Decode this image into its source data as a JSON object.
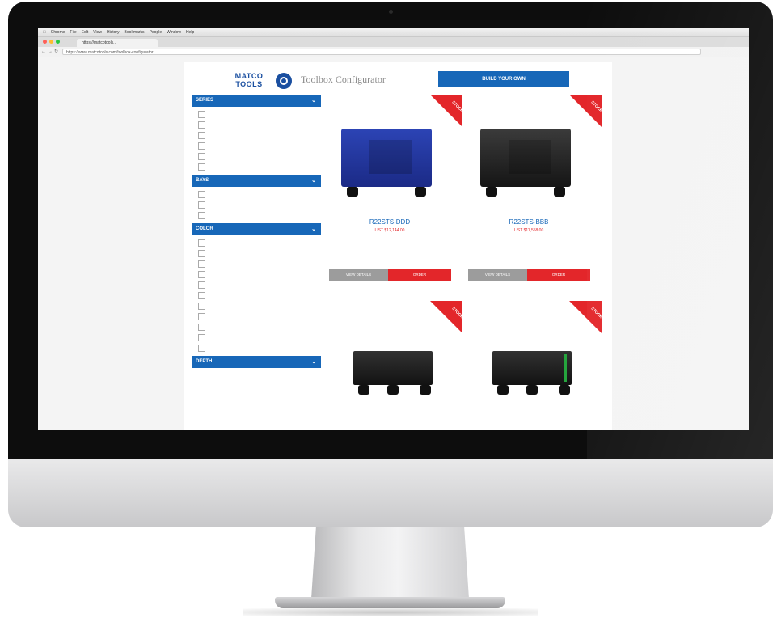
{
  "browser": {
    "menu_items": [
      "Chrome",
      "File",
      "Edit",
      "View",
      "History",
      "Bookmarks",
      "People",
      "Window",
      "Help"
    ],
    "tab_title": "https://matcotools...",
    "url": "https://www.matcotools.com/toolbox-configurator"
  },
  "page": {
    "logo_text": "MATCO TOOLS",
    "title": "Toolbox Configurator",
    "build_button": "BUILD YOUR OWN"
  },
  "filters": [
    {
      "label": "SERIES",
      "items": [
        "",
        "",
        "",
        "",
        "",
        ""
      ]
    },
    {
      "label": "BAYS",
      "items": [
        "",
        "",
        ""
      ]
    },
    {
      "label": "COLOR",
      "items": [
        "",
        "",
        "",
        "",
        "",
        "",
        "",
        "",
        "",
        "",
        ""
      ]
    },
    {
      "label": "DEPTH",
      "items": []
    }
  ],
  "products": [
    {
      "model": "R22STS-DDD",
      "price": "LIST $12,144.00",
      "desc": "",
      "stock": "STOCK",
      "color": "#2c44b5",
      "details_label": "VIEW DETAILS",
      "order_label": "ORDER"
    },
    {
      "model": "R22STS-BBB",
      "price": "LIST $11,558.00",
      "desc": "",
      "stock": "STOCK",
      "color": "#2a2a2a",
      "details_label": "VIEW DETAILS",
      "order_label": "ORDER"
    },
    {
      "model": "",
      "price": "",
      "desc": "",
      "stock": "STOCK",
      "color": "#1e1e1e"
    },
    {
      "model": "",
      "price": "",
      "desc": "",
      "stock": "STOCK",
      "color": "#1e1e1e",
      "accent": "#25a53d"
    }
  ],
  "colors": {
    "brand_blue": "#1767b8",
    "stock_red": "#e3262a"
  }
}
